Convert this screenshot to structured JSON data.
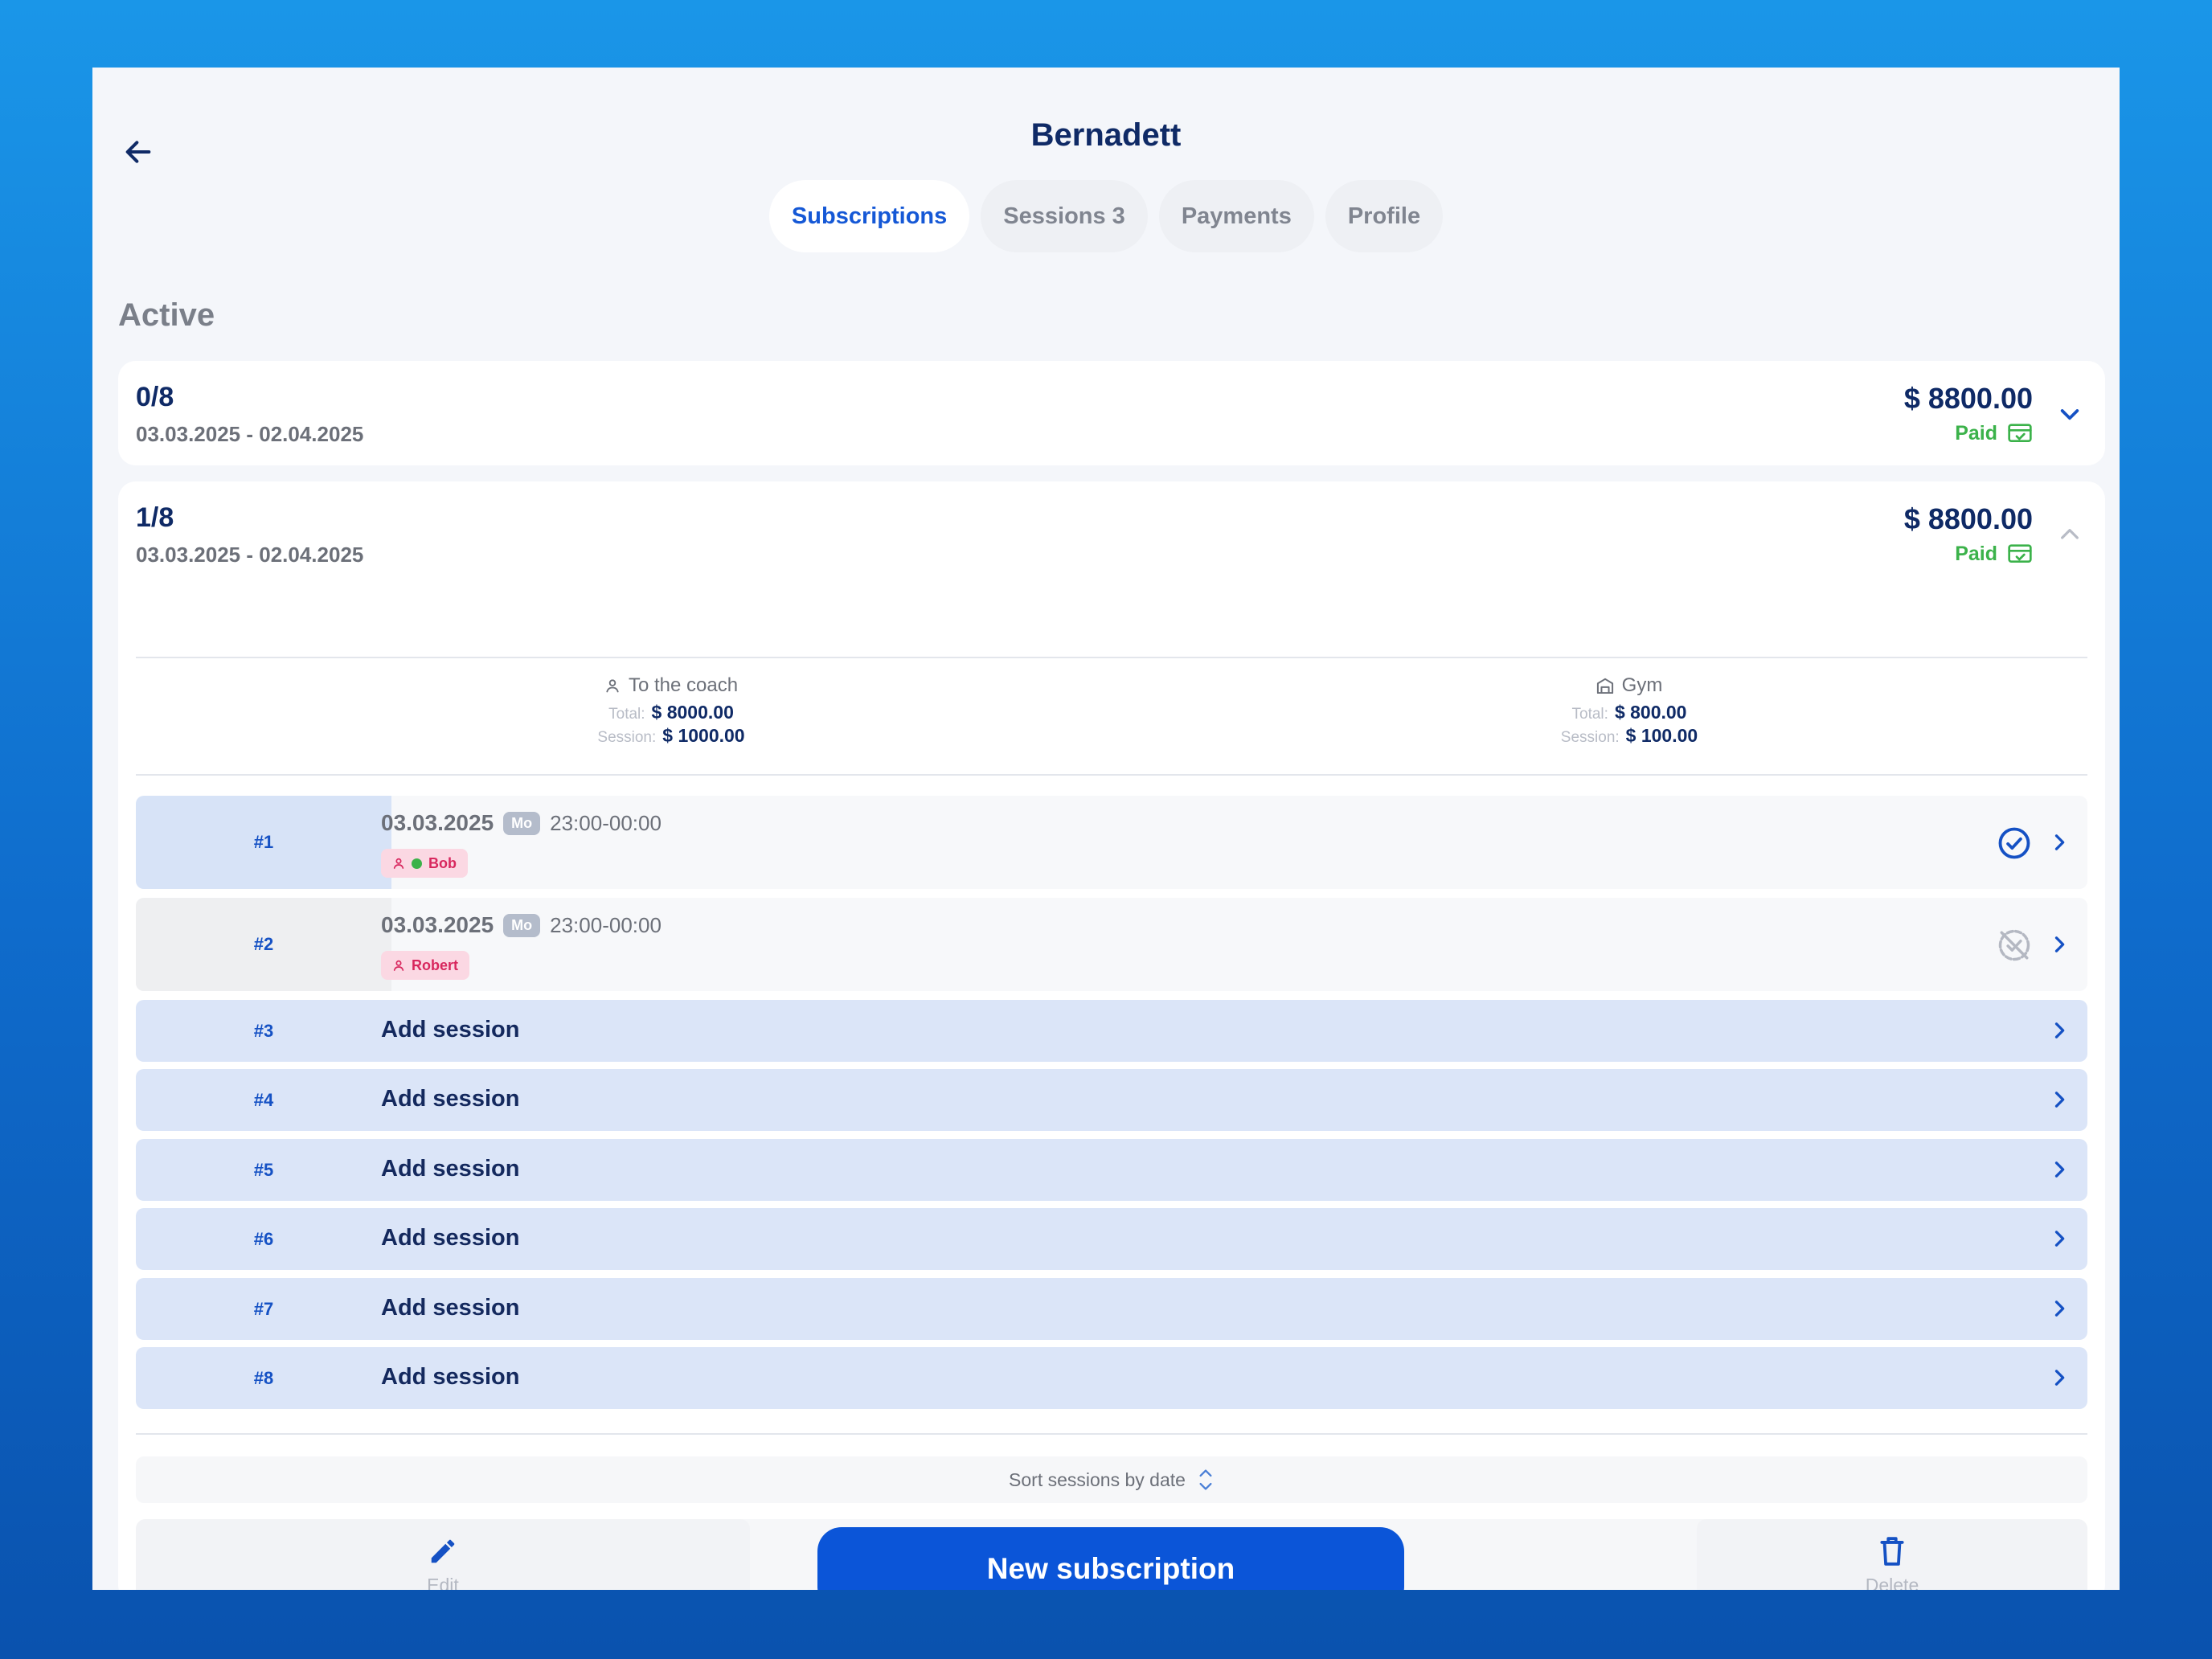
{
  "header": {
    "title": "Bernadett"
  },
  "tabs": [
    {
      "label": "Subscriptions"
    },
    {
      "label": "Sessions 3"
    },
    {
      "label": "Payments"
    },
    {
      "label": "Profile"
    }
  ],
  "section": {
    "label": "Active"
  },
  "subscriptions": [
    {
      "count": "0/8",
      "range": "03.03.2025 - 02.04.2025",
      "price": "$ 8800.00",
      "status": "Paid"
    },
    {
      "count": "1/8",
      "range": "03.03.2025 - 02.04.2025",
      "price": "$ 8800.00",
      "status": "Paid",
      "split": {
        "coach": {
          "label": "To the coach",
          "total_label": "Total:",
          "total": "$ 8000.00",
          "session_label": "Session:",
          "session": "$ 1000.00"
        },
        "gym": {
          "label": "Gym",
          "total_label": "Total:",
          "total": "$ 800.00",
          "session_label": "Session:",
          "session": "$ 100.00"
        }
      },
      "sessions": [
        {
          "num": "#1",
          "date": "03.03.2025",
          "day": "Mo",
          "time": "23:00-00:00",
          "person": "Bob"
        },
        {
          "num": "#2",
          "date": "03.03.2025",
          "day": "Mo",
          "time": "23:00-00:00",
          "person": "Robert"
        }
      ],
      "add_rows": [
        {
          "num": "#3",
          "label": "Add session"
        },
        {
          "num": "#4",
          "label": "Add session"
        },
        {
          "num": "#5",
          "label": "Add session"
        },
        {
          "num": "#6",
          "label": "Add session"
        },
        {
          "num": "#7",
          "label": "Add session"
        },
        {
          "num": "#8",
          "label": "Add session"
        }
      ],
      "sort_label": "Sort sessions by date",
      "actions": {
        "edit": "Edit",
        "new_subscription": "New subscription",
        "delete": "Delete"
      }
    }
  ],
  "colors": {
    "accent": "#0b55d8",
    "paid": "#3bb24a",
    "chip": "#d8275e"
  }
}
